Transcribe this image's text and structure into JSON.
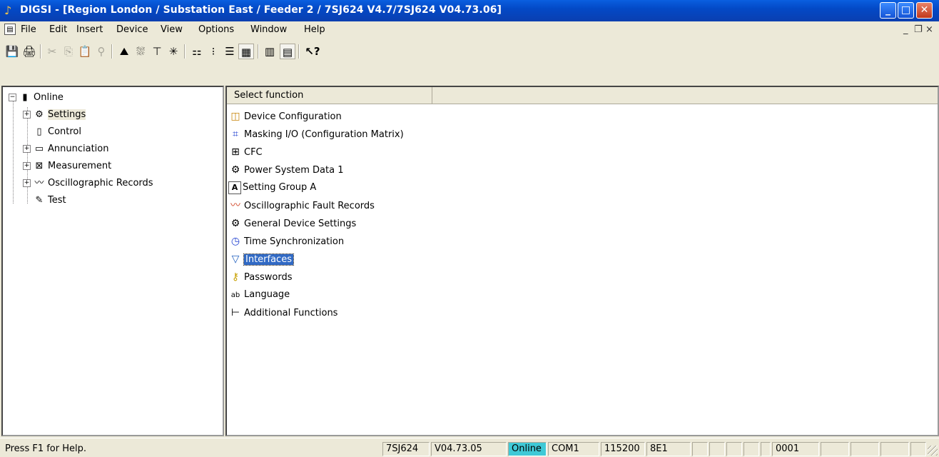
{
  "window": {
    "title": "DIGSI - [Region London / Substation East / Feeder 2 / 7SJ624 V4.7/7SJ624 V04.73.06]",
    "minimize": "_",
    "maximize": "□",
    "close": "✕"
  },
  "menu": {
    "items": [
      "File",
      "Edit",
      "Insert",
      "Device",
      "View",
      "Options",
      "Window",
      "Help"
    ],
    "mdi_minimize": "_",
    "mdi_restore": "❐",
    "mdi_close": "×"
  },
  "toolbar": {
    "buttons": [
      {
        "icon": "save-icon",
        "glyph": "💾"
      },
      {
        "icon": "print-icon",
        "glyph": "🖨"
      },
      {
        "icon": "cut-icon",
        "glyph": "✂"
      },
      {
        "icon": "copy-icon",
        "glyph": "⎘"
      },
      {
        "icon": "paste-icon",
        "glyph": "📋"
      },
      {
        "icon": "paste-special-icon",
        "glyph": "⚲"
      },
      {
        "icon": "device-status-icon",
        "glyph": "⛰"
      },
      {
        "icon": "compare-icon",
        "glyph": "⛆"
      },
      {
        "icon": "transfer-icon",
        "glyph": "⊤"
      },
      {
        "icon": "reset-icon",
        "glyph": "✳"
      },
      {
        "icon": "small-icons-icon",
        "glyph": "⚏"
      },
      {
        "icon": "list-icon",
        "glyph": "⁝"
      },
      {
        "icon": "details-icon",
        "glyph": "☰"
      },
      {
        "icon": "grid-icon",
        "glyph": "▦"
      },
      {
        "icon": "connect-icon",
        "glyph": "▥"
      },
      {
        "icon": "disconnect-icon",
        "glyph": "▤"
      },
      {
        "icon": "help-pointer-icon",
        "glyph": "↖?"
      }
    ]
  },
  "tree": {
    "root": "Online",
    "items": [
      "Settings",
      "Control",
      "Annunciation",
      "Measurement",
      "Oscillographic Records",
      "Test"
    ]
  },
  "list": {
    "header": "Select function",
    "items": [
      {
        "label": "Device Configuration",
        "icon": "device-configuration-icon",
        "glyph": "◫"
      },
      {
        "label": "Masking I/O (Configuration Matrix)",
        "icon": "matrix-icon",
        "glyph": "⌗"
      },
      {
        "label": "CFC",
        "icon": "cfc-icon",
        "glyph": "⊞"
      },
      {
        "label": "Power System Data 1",
        "icon": "power-system-icon",
        "glyph": "⚙"
      },
      {
        "label": "Setting Group A",
        "icon": "setting-group-icon",
        "glyph": "A"
      },
      {
        "label": "Oscillographic Fault Records",
        "icon": "fault-records-icon",
        "glyph": "〰"
      },
      {
        "label": "General Device Settings",
        "icon": "general-settings-icon",
        "glyph": "⚙"
      },
      {
        "label": "Time Synchronization",
        "icon": "clock-icon",
        "glyph": "◷"
      },
      {
        "label": "Interfaces",
        "icon": "interfaces-icon",
        "glyph": "▽"
      },
      {
        "label": "Passwords",
        "icon": "key-icon",
        "glyph": "⚷"
      },
      {
        "label": "Language",
        "icon": "language-icon",
        "glyph": "ab"
      },
      {
        "label": "Additional Functions",
        "icon": "additional-functions-icon",
        "glyph": "⊢"
      }
    ],
    "selected": "Interfaces"
  },
  "statusbar": {
    "help": "Press F1 for Help.",
    "device": "7SJ624",
    "version": "V04.73.05",
    "mode": "Online",
    "port": "COM1",
    "baud": "115200",
    "frame": "8E1",
    "address": "0001"
  },
  "colors": {
    "online_indicator": "#3fc9d6",
    "selection": "#316ac5",
    "titlebar": "#0349c6"
  }
}
